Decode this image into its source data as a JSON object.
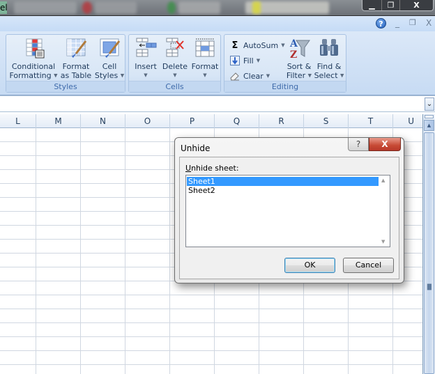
{
  "taskbar": {
    "app_fragment_text": "el",
    "window_controls": [
      "minimize",
      "restore",
      "close"
    ]
  },
  "excel_window_controls": {
    "help": "?",
    "minimize": "_",
    "restore": "❐",
    "close": "X"
  },
  "ribbon": {
    "groups": [
      {
        "name": "Styles",
        "buttons": [
          {
            "line1": "Conditional",
            "line2": "Formatting",
            "icon": "conditional-formatting-icon"
          },
          {
            "line1": "Format",
            "line2": "as Table",
            "icon": "format-as-table-icon"
          },
          {
            "line1": "Cell",
            "line2": "Styles",
            "icon": "cell-styles-icon"
          }
        ]
      },
      {
        "name": "Cells",
        "buttons": [
          {
            "line1": "Insert",
            "icon": "insert-cells-icon"
          },
          {
            "line1": "Delete",
            "icon": "delete-cells-icon"
          },
          {
            "line1": "Format",
            "icon": "format-cells-icon"
          }
        ]
      },
      {
        "name": "Editing",
        "small_buttons": [
          {
            "label": "AutoSum",
            "icon": "sigma-icon"
          },
          {
            "label": "Fill",
            "icon": "fill-down-icon"
          },
          {
            "label": "Clear",
            "icon": "eraser-icon"
          }
        ],
        "buttons": [
          {
            "line1": "Sort &",
            "line2": "Filter",
            "icon": "sort-filter-icon"
          },
          {
            "line1": "Find &",
            "line2": "Select",
            "icon": "binoculars-icon"
          }
        ]
      }
    ]
  },
  "formula_bar": {
    "value": "",
    "expand_glyph": "¥"
  },
  "columns": [
    "L",
    "M",
    "N",
    "O",
    "P",
    "Q",
    "R",
    "S",
    "T",
    "U"
  ],
  "dialog": {
    "title": "Unhide",
    "help_glyph": "?",
    "close_glyph": "X",
    "label_accel": "U",
    "label_rest": "nhide sheet:",
    "sheets": [
      "Sheet1",
      "Sheet2"
    ],
    "selected_index": 0,
    "ok_label": "OK",
    "cancel_label": "Cancel"
  }
}
